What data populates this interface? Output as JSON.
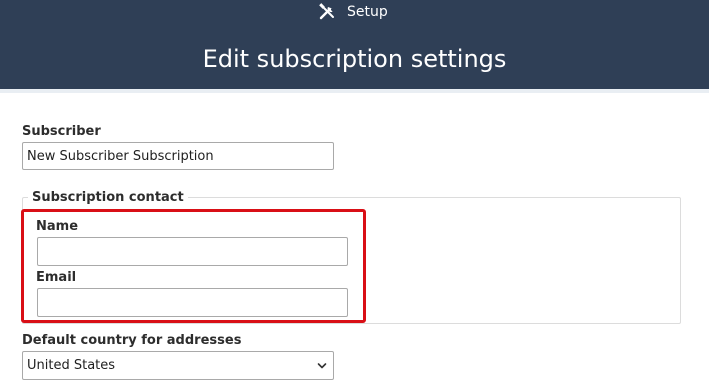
{
  "header": {
    "setup_label": "Setup",
    "setup_icon": "tools-icon",
    "title": "Edit subscription settings",
    "background": "#2f3f56"
  },
  "form": {
    "subscriber": {
      "label": "Subscriber",
      "value": "New Subscriber Subscription"
    },
    "contact": {
      "legend": "Subscription contact",
      "name_label": "Name",
      "name_value": "",
      "email_label": "Email",
      "email_value": ""
    },
    "country": {
      "label": "Default country for addresses",
      "selected": "United States",
      "icon": "chevron-down-icon"
    }
  },
  "highlight_color": "#d90f16"
}
